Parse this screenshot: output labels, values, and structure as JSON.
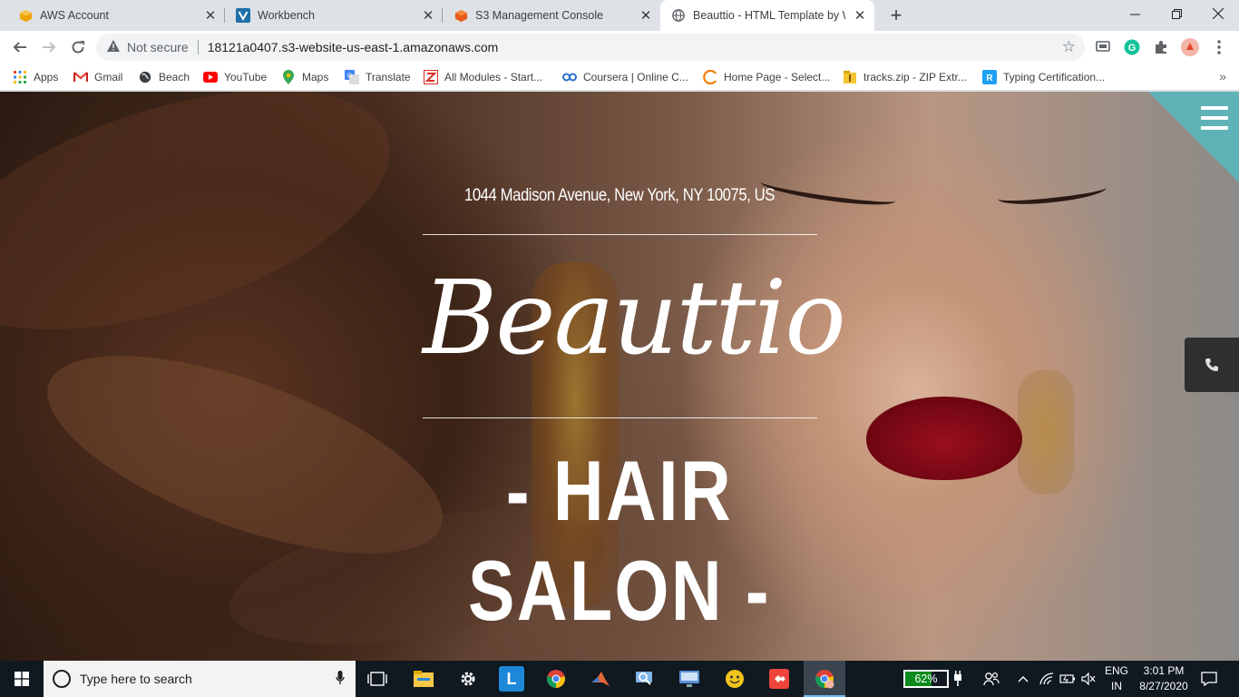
{
  "browser": {
    "tabs": [
      {
        "title": "AWS Account",
        "icon": "aws-cube-icon",
        "active": false
      },
      {
        "title": "Workbench",
        "icon": "workbench-v-icon",
        "active": false
      },
      {
        "title": "S3 Management Console",
        "icon": "s3-icon",
        "active": false
      },
      {
        "title": "Beauttio - HTML Template by Wo",
        "icon": "globe-icon",
        "active": true
      }
    ],
    "address_bar": {
      "security_label": "Not secure",
      "url": "18121a0407.s3-website-us-east-1.amazonaws.com"
    },
    "bookmarks": [
      {
        "label": "Apps",
        "icon": "apps-grid-icon"
      },
      {
        "label": "Gmail",
        "icon": "gmail-icon"
      },
      {
        "label": "Beach",
        "icon": "globe-icon"
      },
      {
        "label": "YouTube",
        "icon": "youtube-icon"
      },
      {
        "label": "Maps",
        "icon": "maps-icon"
      },
      {
        "label": "Translate",
        "icon": "translate-icon"
      },
      {
        "label": "All Modules - Start...",
        "icon": "modules-icon"
      },
      {
        "label": "Coursera | Online C...",
        "icon": "coursera-icon"
      },
      {
        "label": "Home Page - Select...",
        "icon": "home-page-icon"
      },
      {
        "label": "tracks.zip - ZIP Extr...",
        "icon": "zip-icon"
      },
      {
        "label": "Typing Certification...",
        "icon": "typing-icon"
      }
    ]
  },
  "site": {
    "address": "1044 Madison Avenue, New York, NY 10075, US",
    "brand": "Beauttio",
    "tagline": "- HAIR SALON -",
    "accent_color": "#5fb3b7"
  },
  "taskbar": {
    "search_placeholder": "Type here to search",
    "battery_label": "62%",
    "battery_level": 0.62,
    "language_line1": "ENG",
    "language_line2": "IN",
    "time": "3:01 PM",
    "date": "8/27/2020"
  }
}
